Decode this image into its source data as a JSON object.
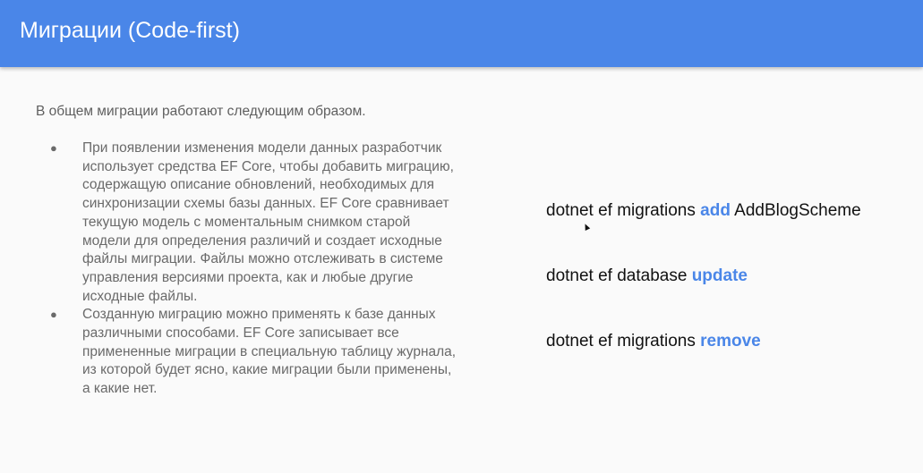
{
  "header": {
    "title": "Миграции (Code-first)",
    "background_color": "#4a86e8"
  },
  "content": {
    "intro": "В общем миграции работают следующим образом.",
    "bullets": [
      "При появлении изменения модели данных разработчик использует средства EF Core, чтобы добавить миграцию, содержащую описание обновлений, необходимых для синхронизации схемы базы данных. EF Core сравнивает текущую модель с моментальным снимком старой модели для определения различий и создает исходные файлы миграции. Файлы можно отслеживать в системе управления версиями проекта, как и любые другие исходные файлы.",
      "Созданную миграцию можно применять к базе данных различными способами. EF Core записывает все примененные миграции в специальную таблицу журнала, из которой будет ясно, какие миграции были применены, а какие нет."
    ],
    "bullet_glyph": "●"
  },
  "commands": [
    {
      "prefix": "dotnet ef migrations ",
      "keyword": "add",
      "suffix": " AddBlogScheme"
    },
    {
      "prefix": "dotnet ef database ",
      "keyword": "update",
      "suffix": ""
    },
    {
      "prefix": "dotnet ef migrations ",
      "keyword": "remove",
      "suffix": ""
    }
  ],
  "colors": {
    "accent": "#4a86e8",
    "body_text": "#6a6a6a",
    "command_text": "#111111"
  }
}
